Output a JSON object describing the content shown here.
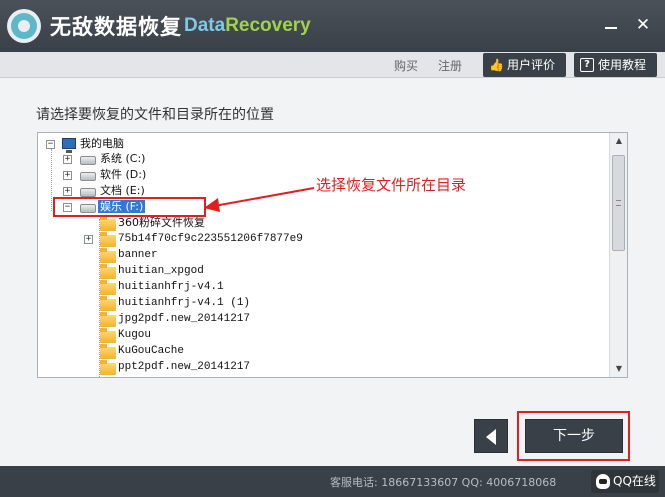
{
  "window": {
    "title": "无敌数据恢复",
    "subtitle_a": "Data",
    "subtitle_b": "Recovery"
  },
  "toolbar": {
    "buy": "购买",
    "register": "注册",
    "review": "用户评价",
    "tutorial": "使用教程"
  },
  "main": {
    "prompt": "请选择要恢复的文件和目录所在的位置"
  },
  "tree": {
    "root": "我的电脑",
    "drives": [
      {
        "label": "系统 (C:)"
      },
      {
        "label": "软件 (D:)"
      },
      {
        "label": "文档 (E:)"
      },
      {
        "label": "娱乐 (F:)"
      }
    ],
    "folders": [
      "360粉碎文件恢复",
      "75b14f70cf9c223551206f7877e9",
      "banner",
      "huitian_xpgod",
      "huitianhfrj-v4.1",
      "huitianhfrj-v4.1 (1)",
      "jpg2pdf.new_20141217",
      "Kugou",
      "KuGouCache",
      "ppt2pdf.new_20141217"
    ]
  },
  "annotation": {
    "text": "选择恢复文件所在目录"
  },
  "buttons": {
    "next": "下一步"
  },
  "footer": {
    "contact": "客服电话: 18667133607 QQ: 4006718068",
    "qq": "QQ在线"
  },
  "colors": {
    "titlebar": "#3a4047",
    "highlight": "#e02020",
    "selection": "#3478d4"
  }
}
